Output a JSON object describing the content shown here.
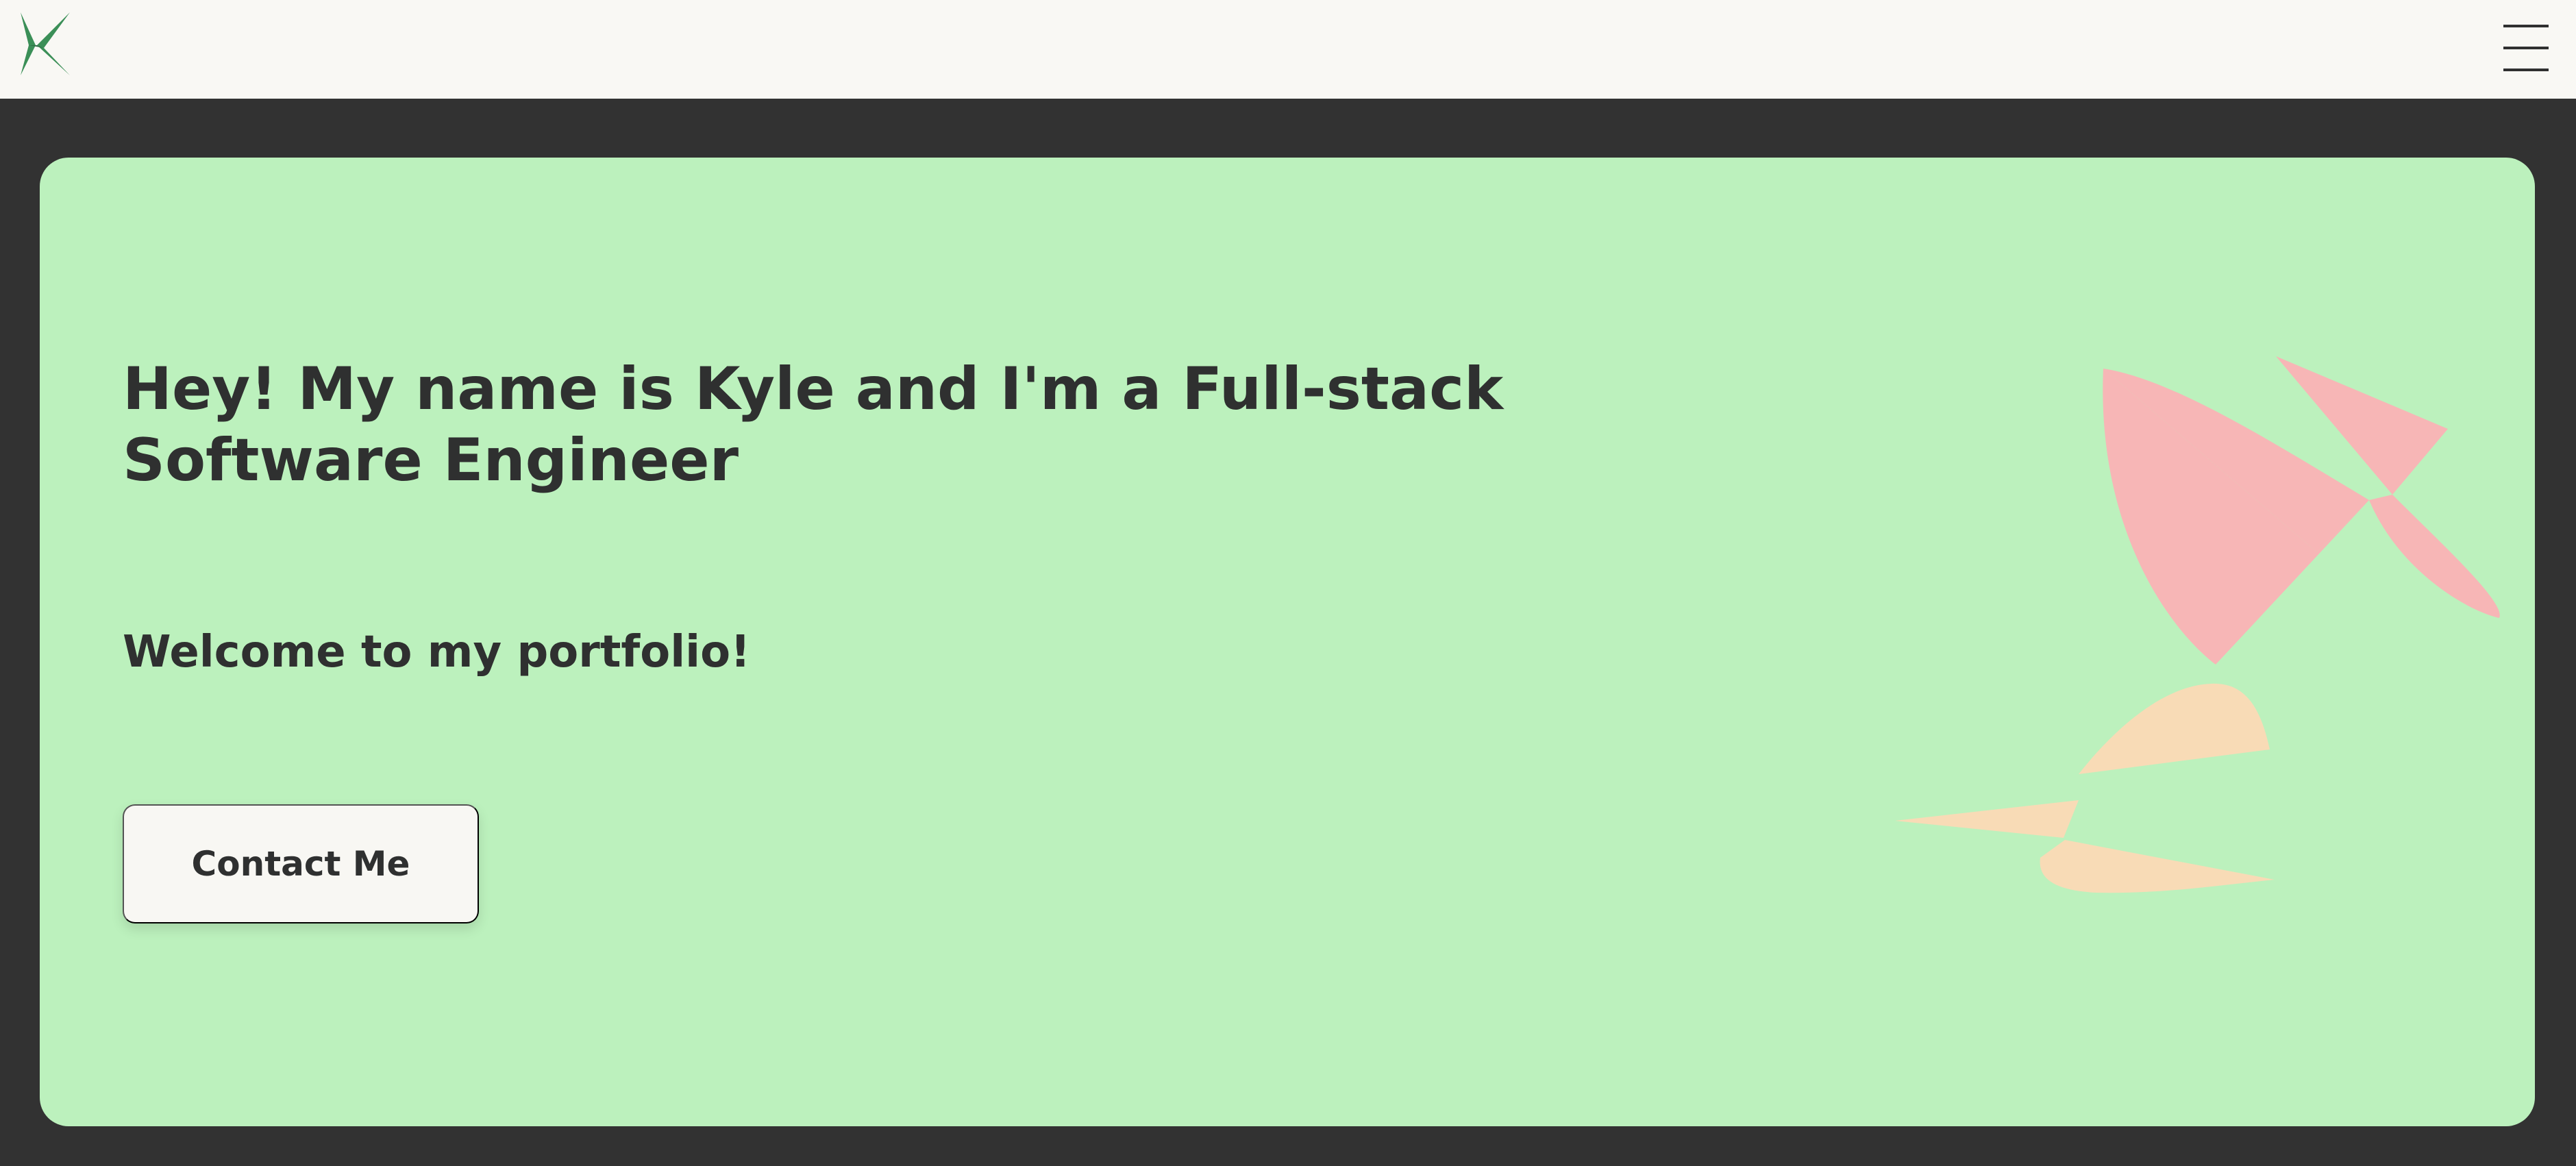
{
  "header": {
    "logo_icon": "k-star-logo-icon",
    "menu_icon": "hamburger-menu-icon"
  },
  "hero": {
    "title": "Hey! My name is Kyle and I'm a Full-stack Software Engineer",
    "subtitle": "Welcome to my portfolio!",
    "cta_label": "Contact Me"
  },
  "decorations": {
    "pink_shape_icon": "pink-abstract-star-icon",
    "peach_shape_icon": "peach-abstract-star-icon"
  },
  "colors": {
    "header_background": "#f9f8f4",
    "page_background": "#323232",
    "card_background": "#bcf1bd",
    "text": "#2f3030",
    "logo_green": "#3b8f57",
    "pink_shape": "#f7b6b6",
    "peach_shape": "#f8dbb6",
    "button_background": "#f8f7f3"
  }
}
